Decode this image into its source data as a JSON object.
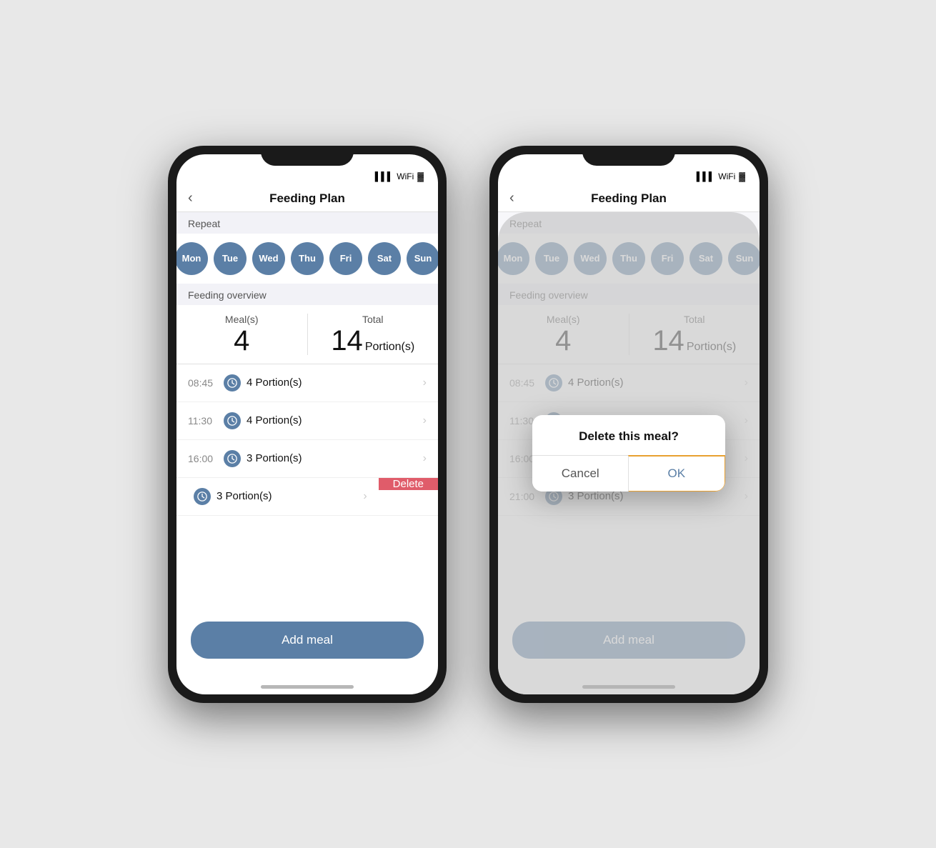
{
  "app": {
    "title": "Feeding Plan",
    "back_label": "‹"
  },
  "phone1": {
    "repeat_label": "Repeat",
    "days": [
      "Mon",
      "Tue",
      "Wed",
      "Thu",
      "Fri",
      "Sat",
      "Sun"
    ],
    "feeding_overview_label": "Feeding overview",
    "meals_col_label": "Meal(s)",
    "total_col_label": "Total",
    "meals_count": "4",
    "total_value": "14",
    "total_unit": "Portion(s)",
    "meals": [
      {
        "time": "08:45",
        "desc": "4 Portion(s)"
      },
      {
        "time": "11:30",
        "desc": "4 Portion(s)"
      },
      {
        "time": "16:00",
        "desc": "3 Portion(s)"
      },
      {
        "time": "",
        "desc": "3 Portion(s)",
        "swipe_delete": true
      }
    ],
    "delete_label": "Delete",
    "add_meal_label": "Add meal"
  },
  "phone2": {
    "repeat_label": "Repeat",
    "days": [
      "Mon",
      "Tue",
      "Wed",
      "Thu",
      "Fri",
      "Sat",
      "Sun"
    ],
    "feeding_overview_label": "Feeding overview",
    "meals_col_label": "Meal(s)",
    "total_col_label": "Total",
    "meals_count": "4",
    "total_value": "14",
    "total_unit": "Portion(s)",
    "meals": [
      {
        "time": "08:45",
        "desc": "4 Portion(s)"
      },
      {
        "time": "11:30",
        "desc": "4 Portion(s)"
      },
      {
        "time": "16:00",
        "desc": "3 Portion(s)"
      },
      {
        "time": "21:00",
        "desc": "3 Portion(s)"
      }
    ],
    "dialog": {
      "title": "Delete this meal?",
      "cancel_label": "Cancel",
      "ok_label": "OK"
    },
    "add_meal_label": "Add meal"
  }
}
